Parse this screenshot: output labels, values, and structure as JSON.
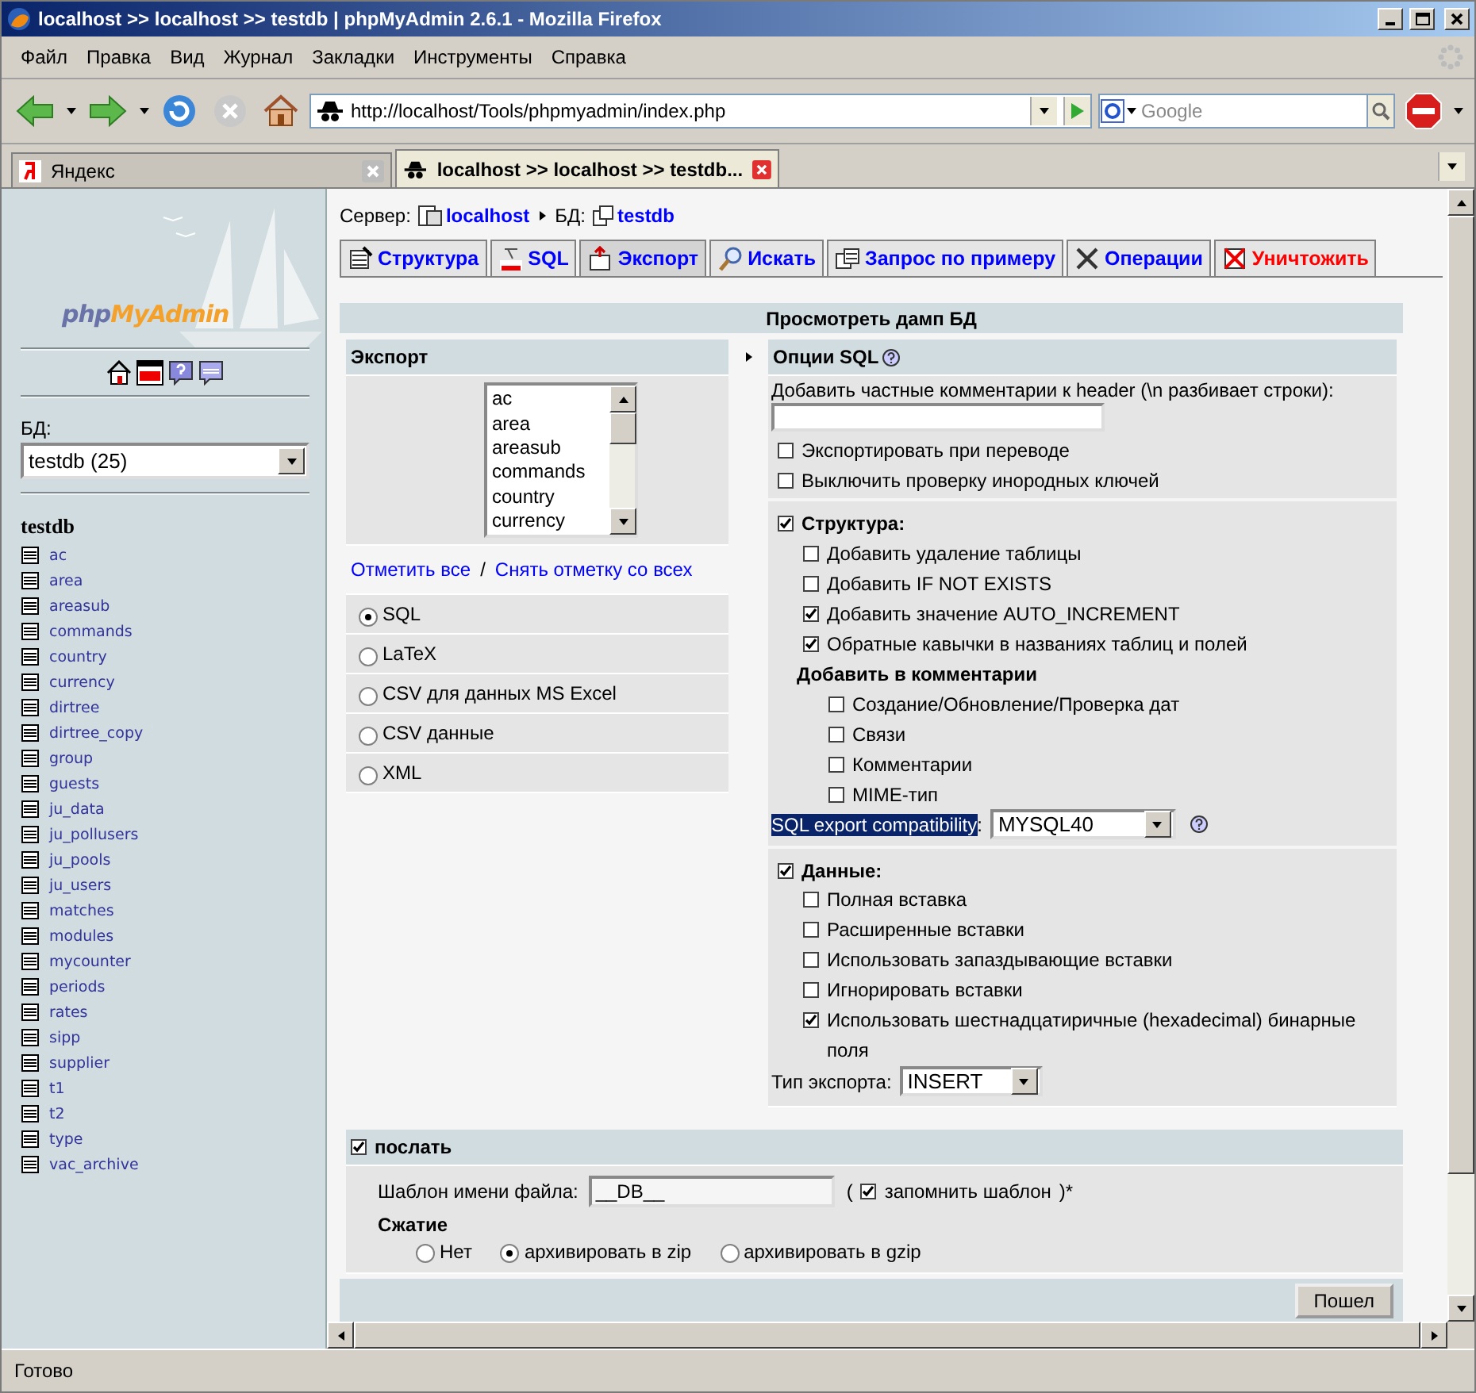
{
  "window": {
    "title": "localhost >> localhost >> testdb | phpMyAdmin 2.6.1 - Mozilla Firefox"
  },
  "menu": [
    "Файл",
    "Правка",
    "Вид",
    "Журнал",
    "Закладки",
    "Инструменты",
    "Справка"
  ],
  "navigation": {
    "url": "http://localhost/Tools/phpmyadmin/index.php",
    "search_placeholder": "Google"
  },
  "browser_tabs": [
    {
      "label": "Яндекс",
      "selected": false
    },
    {
      "label": "localhost >> localhost >> testdb...",
      "selected": true
    }
  ],
  "sidebar": {
    "logo_prefix": "php",
    "logo_suffix": "MyAdmin",
    "db_label": "БД:",
    "db_select": "testdb (25)",
    "db_name": "testdb",
    "tables": [
      "ac",
      "area",
      "areasub",
      "commands",
      "country",
      "currency",
      "dirtree",
      "dirtree_copy",
      "group",
      "guests",
      "ju_data",
      "ju_pollusers",
      "ju_pools",
      "ju_users",
      "matches",
      "modules",
      "mycounter",
      "periods",
      "rates",
      "sipp",
      "supplier",
      "t1",
      "t2",
      "type",
      "vac_archive"
    ]
  },
  "breadcrumb": {
    "server_label": "Сервер:",
    "server": "localhost",
    "db_label": "БД:",
    "db": "testdb"
  },
  "tabs": [
    {
      "label": "Структура",
      "selected": false,
      "kind": "normal"
    },
    {
      "label": "SQL",
      "selected": false,
      "kind": "normal"
    },
    {
      "label": "Экспорт",
      "selected": true,
      "kind": "normal"
    },
    {
      "label": "Искать",
      "selected": false,
      "kind": "normal"
    },
    {
      "label": "Запрос по примеру",
      "selected": false,
      "kind": "normal"
    },
    {
      "label": "Операции",
      "selected": false,
      "kind": "normal"
    },
    {
      "label": "Уничтожить",
      "selected": false,
      "kind": "danger"
    }
  ],
  "dump_title": "Просмотреть дамп БД",
  "export": {
    "title": "Экспорт",
    "tables": [
      "ac",
      "area",
      "areasub",
      "commands",
      "country",
      "currency"
    ],
    "select_all": "Отметить все",
    "separator": "/",
    "unselect_all": "Снять отметку со всех",
    "formats": [
      {
        "label": "SQL",
        "selected": true
      },
      {
        "label": "LaTeX",
        "selected": false
      },
      {
        "label": "CSV для данных MS Excel",
        "selected": false
      },
      {
        "label": "CSV данные",
        "selected": false
      },
      {
        "label": "XML",
        "selected": false
      }
    ]
  },
  "sql_options": {
    "title": "Опции SQL",
    "comment_label": "Добавить частные комментарии к header (\\n разбивает строки):",
    "general": [
      {
        "label": "Экспортировать при переводе",
        "checked": false
      },
      {
        "label": "Выключить проверку инородных ключей",
        "checked": false
      }
    ],
    "structure": {
      "label": "Структура:",
      "checked": true,
      "options": [
        {
          "label": "Добавить удаление таблицы",
          "checked": false
        },
        {
          "label": "Добавить IF NOT EXISTS",
          "checked": false
        },
        {
          "label": "Добавить значение AUTO_INCREMENT",
          "checked": true
        },
        {
          "label": "Обратные кавычки в названиях таблиц и полей",
          "checked": true
        }
      ],
      "comments_title": "Добавить в комментарии",
      "comments": [
        {
          "label": "Создание/Обновление/Проверка дат",
          "checked": false
        },
        {
          "label": "Связи",
          "checked": false
        },
        {
          "label": "Комментарии",
          "checked": false
        },
        {
          "label": "MIME-тип",
          "checked": false
        }
      ],
      "compat_label": "SQL export compatibility",
      "compat_colon": ":",
      "compat_value": "MYSQL40"
    },
    "data": {
      "label": "Данные:",
      "checked": true,
      "options": [
        {
          "label": "Полная вставка",
          "checked": false
        },
        {
          "label": "Расширенные вставки",
          "checked": false
        },
        {
          "label": "Использовать запаздывающие вставки",
          "checked": false
        },
        {
          "label": "Игнорировать вставки",
          "checked": false
        },
        {
          "label": "Использовать шестнадцатиричные (hexadecimal) бинарные поля",
          "checked": true
        }
      ],
      "type_label": "Тип экспорта:",
      "type_value": "INSERT"
    }
  },
  "save": {
    "label": "послать",
    "checked": true,
    "filename_label": "Шаблон имени файла:",
    "filename_value": "__DB__",
    "paren_open": "(",
    "remember_label": "запомнить шаблон",
    "remember_checked": true,
    "paren_close": ")*",
    "compression_title": "Сжатие",
    "compression": [
      {
        "label": "Нет",
        "selected": false
      },
      {
        "label": "архивировать в zip",
        "selected": true
      },
      {
        "label": "архивировать в gzip",
        "selected": false
      }
    ]
  },
  "go_button": "Пошел",
  "status": "Готово"
}
